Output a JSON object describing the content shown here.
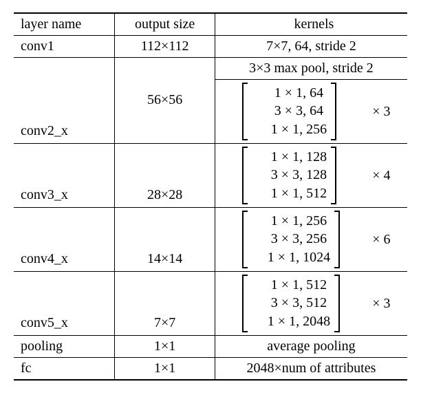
{
  "header": {
    "c0": "layer name",
    "c1": "output size",
    "c_kernels": "kernels"
  },
  "rows": {
    "conv1": {
      "name": "conv1",
      "size": "112×112",
      "desc": "7×7, 64, stride 2"
    },
    "conv2": {
      "name": "conv2_x",
      "size": "56×56",
      "pool": "3×3 max pool, stride 2",
      "b1": "1 × 1, 64",
      "b2": "3 × 3, 64",
      "b3": "1 × 1, 256",
      "mult": "× 3"
    },
    "conv3": {
      "name": "conv3_x",
      "size": "28×28",
      "b1": "1 × 1, 128",
      "b2": "3 × 3, 128",
      "b3": "1 × 1, 512",
      "mult": "× 4"
    },
    "conv4": {
      "name": "conv4_x",
      "size": "14×14",
      "b1": "1 × 1, 256",
      "b2": "3 × 3, 256",
      "b3": "1 × 1, 1024",
      "mult": "× 6"
    },
    "conv5": {
      "name": "conv5_x",
      "size": "7×7",
      "b1": "1 × 1, 512",
      "b2": "3 × 3, 512",
      "b3": "1 × 1, 2048",
      "mult": "× 3"
    },
    "pool": {
      "name": "pooling",
      "size": "1×1",
      "desc": "average pooling"
    },
    "fc": {
      "name": "fc",
      "size": "1×1",
      "desc": "2048×num of attributes"
    }
  },
  "chart_data": {
    "type": "table",
    "title": "ResNet-50 style architecture table",
    "columns": [
      "layer name",
      "output size",
      "kernels"
    ],
    "rows": [
      [
        "conv1",
        "112×112",
        "7×7, 64, stride 2"
      ],
      [
        "conv2_x",
        "56×56",
        "3×3 max pool, stride 2 ; [1×1,64 | 3×3,64 | 1×1,256] × 3"
      ],
      [
        "conv3_x",
        "28×28",
        "[1×1,128 | 3×3,128 | 1×1,512] × 4"
      ],
      [
        "conv4_x",
        "14×14",
        "[1×1,256 | 3×3,256 | 1×1,1024] × 6"
      ],
      [
        "conv5_x",
        "7×7",
        "[1×1,512 | 3×3,512 | 1×1,2048] × 3"
      ],
      [
        "pooling",
        "1×1",
        "average pooling"
      ],
      [
        "fc",
        "1×1",
        "2048×num of attributes"
      ]
    ]
  }
}
